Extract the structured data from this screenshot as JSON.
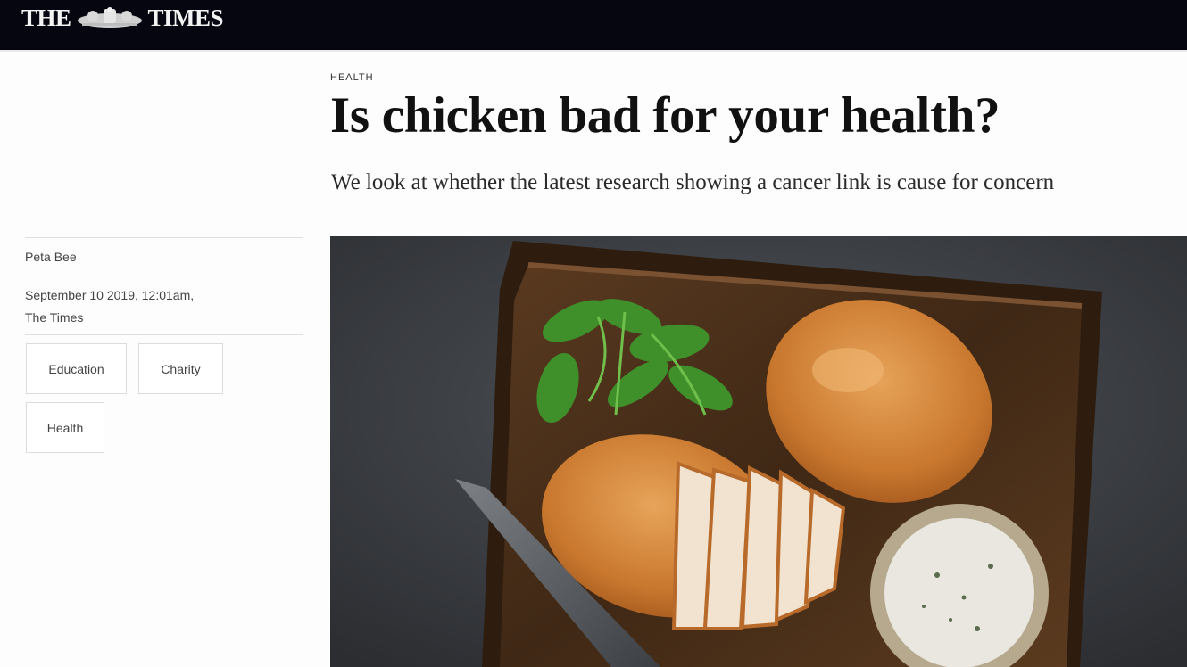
{
  "masthead": {
    "left_word": "THE",
    "right_word": "TIMES",
    "crest_icon": "royal-crest-icon"
  },
  "article": {
    "section": "HEALTH",
    "headline": "Is chicken bad for your health?",
    "standfirst": "We look at whether the latest research showing a cancer link is cause for concern",
    "author": "Peta Bee",
    "date": "September 10 2019, 12:01am,",
    "publication": "The Times"
  },
  "tags": [
    "Education",
    "Charity",
    "Health"
  ],
  "colors": {
    "topbar": "#05060f",
    "text": "#111111",
    "border": "#dcdcdc"
  }
}
